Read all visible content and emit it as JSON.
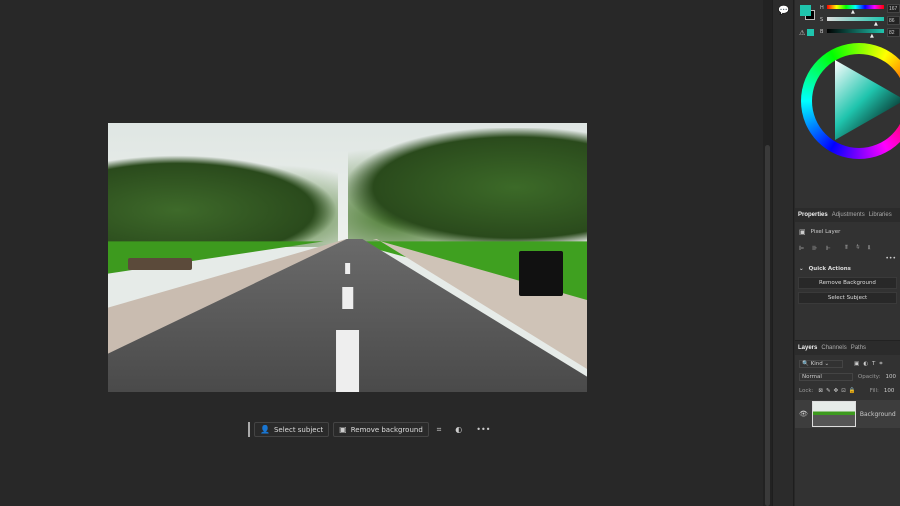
{
  "canvas": {
    "image_name": "road-with-trees"
  },
  "context_bar": {
    "select_subject": "Select subject",
    "remove_background": "Remove background"
  },
  "color": {
    "foreground": "#1fc4ad",
    "background": "#000000",
    "h_label": "H",
    "s_label": "S",
    "b_label": "B",
    "h": "167",
    "s": "86",
    "b": "82",
    "h_fraction": 0.46,
    "s_fraction": 0.86,
    "b_fraction": 0.82
  },
  "properties": {
    "tabs": [
      "Properties",
      "Adjustments",
      "Libraries"
    ],
    "layer_type": "Pixel Layer",
    "quick_actions_title": "Quick Actions",
    "remove_background": "Remove Background",
    "select_subject": "Select Subject"
  },
  "layers": {
    "tabs": [
      "Layers",
      "Channels",
      "Paths"
    ],
    "filter": "Kind",
    "blend_mode": "Normal",
    "opacity_label": "Opacity:",
    "opacity": "100",
    "locks_label": "Lock:",
    "fill_label": "Fill:",
    "fill": "100",
    "items": [
      {
        "name": "Background",
        "visible": true
      }
    ]
  }
}
